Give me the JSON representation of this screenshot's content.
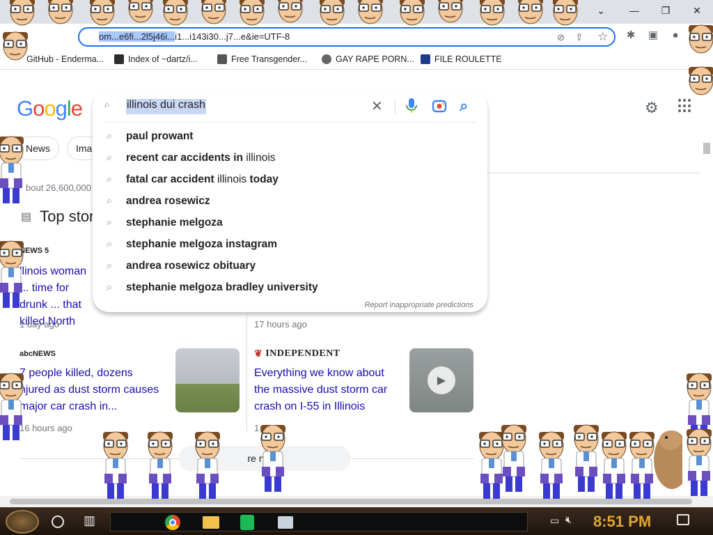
{
  "browser": {
    "url": "om...e6fi...2l5j46i...i1...i143i30...j7...e&ie=UTF-8",
    "url_selected": "om...e6fi...2l5j46i...",
    "bookmarks": [
      {
        "label": "GitHub - Enderma...",
        "color": "#24292f"
      },
      {
        "label": "Index of ~dartz/i...",
        "color": "#2d2d2d"
      },
      {
        "label": "Free Transgender...",
        "color": "#555555"
      },
      {
        "label": "GAY RAPE PORN...",
        "color": "#666666"
      },
      {
        "label": "FILE ROULETTE",
        "color": "#1e3a8a"
      }
    ],
    "window_controls": {
      "minimize": "—",
      "maximize": "❐",
      "close": "✕",
      "dropdown": "⌄"
    }
  },
  "google": {
    "logo": [
      "G",
      "o",
      "o",
      "g",
      "l",
      "e"
    ],
    "logo_colors": [
      "#4285f4",
      "#ea4335",
      "#fbbc05",
      "#4285f4",
      "#34a853",
      "#ea4335"
    ],
    "search_query": "illinois dui crash",
    "suggestions": [
      {
        "bold": "paul prowant",
        "rest": "",
        "bold2": ""
      },
      {
        "bold": "recent car accidents in",
        "rest": " illinois",
        "bold2": ""
      },
      {
        "bold": "fatal car accident",
        "rest": " illinois ",
        "bold2": "today"
      },
      {
        "bold": "andrea rosewicz",
        "rest": "",
        "bold2": ""
      },
      {
        "bold": "stephanie melgoza",
        "rest": "",
        "bold2": ""
      },
      {
        "bold": "stephanie melgoza instagram",
        "rest": "",
        "bold2": ""
      },
      {
        "bold": "andrea rosewicz obituary",
        "rest": "",
        "bold2": ""
      },
      {
        "bold": "stephanie melgoza bradley university",
        "rest": "",
        "bold2": ""
      }
    ],
    "report_link": "Report inappropriate predictions",
    "chips": [
      "News",
      "Ima"
    ],
    "results_stats": "bout 26,600,000",
    "top_stories_heading": "Top stor",
    "stories": [
      {
        "publisher": "NEWS 5",
        "headline": "llinois woman ... time for drunk ... that killed North",
        "age": "1 day ago"
      },
      {
        "publisher": "",
        "headline": "",
        "age": "17 hours ago"
      },
      {
        "publisher": "abcNEWS",
        "headline": "7 people killed, dozens njured as dust storm causes major car crash in...",
        "age": "16 hours ago"
      },
      {
        "publisher": "INDEPENDENT",
        "headline": "Everything we know about the massive dust storm car crash on I-55 in Illinois",
        "age": "1"
      }
    ],
    "more_news": "re news"
  },
  "taskbar": {
    "clock": "8:51 PM"
  }
}
